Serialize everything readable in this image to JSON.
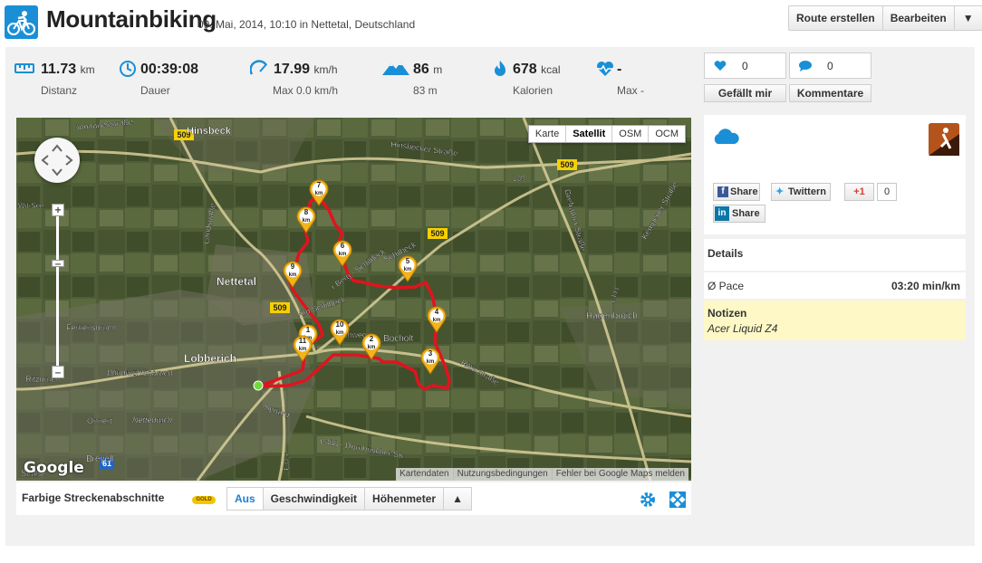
{
  "header": {
    "title": "Mountainbiking",
    "subtitle": "09. Mai, 2014, 10:10 in Nettetal, Deutschland",
    "buttons": {
      "route": "Route erstellen",
      "edit": "Bearbeiten",
      "more": "▼"
    }
  },
  "stats": [
    {
      "icon": "distance-icon",
      "value": "11.73",
      "unit": "km",
      "label": "Distanz"
    },
    {
      "icon": "clock-icon",
      "value": "00:39:08",
      "unit": "",
      "label": "Dauer"
    },
    {
      "icon": "speedometer-icon",
      "value": "17.99",
      "unit": "km/h",
      "label": "Max 0.0 km/h"
    },
    {
      "icon": "mountain-icon",
      "value": "86",
      "unit": "m",
      "label": "83 m"
    },
    {
      "icon": "flame-icon",
      "value": "678",
      "unit": "kcal",
      "label": "Kalorien"
    },
    {
      "icon": "heart-rate-icon",
      "value": "-",
      "unit": "",
      "label": "Max -"
    }
  ],
  "social": {
    "likes_count": "0",
    "comments_count": "0",
    "like_label": "Gefällt mir",
    "comments_label": "Kommentare"
  },
  "map": {
    "types": [
      "Karte",
      "Satellit",
      "OSM",
      "OCM"
    ],
    "selected_type": "Satellit",
    "attribution": [
      "Kartendaten",
      "Nutzungsbedingungen",
      "Fehler bei Google Maps melden"
    ],
    "logo": "Google",
    "places": [
      "Hinsbeck",
      "Johannesstraße",
      "Hinsbecker Straße",
      "Nettetal",
      "Lobberich",
      "Ferkensbruch",
      "Windmühlenbruch",
      "Nettebruch",
      "Onnert",
      "Ritzbruch",
      "Breyell",
      "Bocholt",
      "Hagenbroich",
      "Ritterstraße",
      "Grefrather Straße",
      "Kempener Straße",
      "Landstraße",
      "Schilbeck",
      "L39",
      "L444",
      "L373",
      "L388 - Dornbuscher Str.",
      "Syrtard",
      "Am Schilbeck",
      "r Berg - Schilbeck",
      "Kirchweg",
      "Straße",
      "Wit-See"
    ],
    "road_shields": [
      "509",
      "509",
      "509",
      "509",
      "61"
    ],
    "km_markers": [
      "1",
      "2",
      "3",
      "4",
      "5",
      "6",
      "7",
      "8",
      "9",
      "10",
      "11"
    ],
    "km_unit": "km"
  },
  "toolbar": {
    "label": "Farbige Streckenabschnitte",
    "badge": "GOLD",
    "options": [
      "Aus",
      "Geschwindigkeit",
      "Höhenmeter"
    ],
    "selected": "Aus",
    "expand": "▲"
  },
  "right": {
    "share_fb": "Share",
    "share_tw": "Twittern",
    "share_gplus": "+1",
    "gplus_count": "0",
    "share_in": "Share",
    "details_title": "Details",
    "pace_label": "Ø Pace",
    "pace_value": "03:20 min/km",
    "notes_title": "Notizen",
    "notes_text": "Acer Liquid Z4"
  },
  "colors": {
    "accent": "#1a8fd6",
    "route": "#e0141e",
    "marker": "#f3b31b",
    "notes_bg": "#fdf8c6"
  }
}
